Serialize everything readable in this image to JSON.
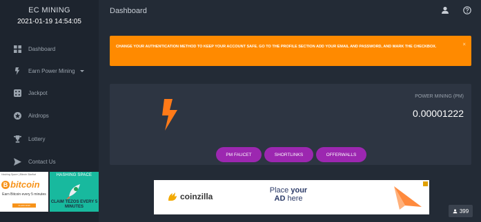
{
  "sidebar": {
    "brand": "EC MINING",
    "datetime": "2021-01-19 14:54:05",
    "items": [
      {
        "label": "Dashboard",
        "icon": "dashboard-icon"
      },
      {
        "label": "Earn Power Mining",
        "icon": "bolt-icon"
      },
      {
        "label": "Jackpot",
        "icon": "dice-icon"
      },
      {
        "label": "Airdrops",
        "icon": "star-icon"
      },
      {
        "label": "Lottery",
        "icon": "trophy-icon"
      },
      {
        "label": "Contact Us",
        "icon": "send-icon"
      }
    ],
    "ad_left": {
      "top_text": "Hashing Space | Bitcoin Starlkat",
      "logo_b": "B",
      "logo_word": "bitcoin",
      "text": "Earn Bitcoin every 5 minutes",
      "cta": "CLAIM NOW"
    },
    "ad_right": {
      "top_text": "HASHING SPACE",
      "text": "CLAIM TEZOS EVERY 5 MINUTES"
    }
  },
  "header": {
    "title": "Dashboard"
  },
  "alert": {
    "message": "CHANGE YOUR AUTHENTICATION METHOD TO KEEP YOUR ACCOUNT SAFE. GO TO THE PROFILE SECTION ADD YOUR EMAIL AND PASSWORD, AND MARK THE CHECKBOX.",
    "close": "×"
  },
  "power_card": {
    "label": "POWER MINING (PM)",
    "value": "0.00001222",
    "buttons": [
      "PM FAUCET",
      "SHORTLINKS",
      "OFFERWALLS"
    ]
  },
  "banner": {
    "brand": "coinzilla",
    "place_line1": "Place",
    "place_your": "your",
    "place_line2": "AD",
    "place_here": "here"
  },
  "counter": {
    "value": "399"
  },
  "colors": {
    "accent_orange": "#ff8a00",
    "button_purple": "#9c27b0",
    "sidebar_bg": "#1d242e",
    "content_bg": "#232b36"
  }
}
